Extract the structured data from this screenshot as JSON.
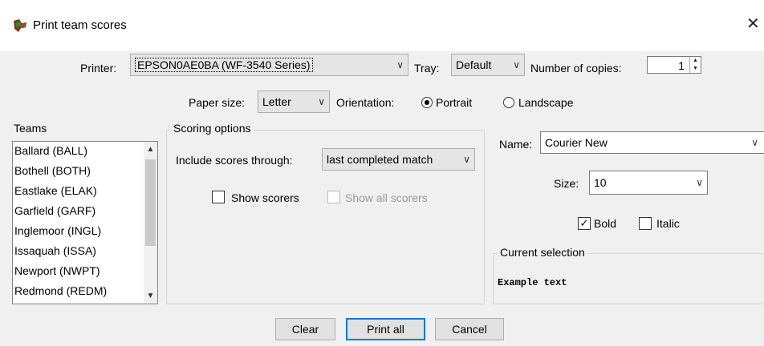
{
  "window": {
    "title": "Print team scores",
    "close_glyph": "✕",
    "icon": "app-icon"
  },
  "printer": {
    "label": "Printer:",
    "value": "EPSON0AE0BA (WF-3540 Series)",
    "tray_label": "Tray:",
    "tray_value": "Default",
    "copies_label": "Number of copies:",
    "copies_value": "1"
  },
  "paper": {
    "size_label": "Paper size:",
    "size_value": "Letter",
    "orientation_label": "Orientation:",
    "portrait_label": "Portrait",
    "landscape_label": "Landscape",
    "orientation_selected": "Portrait"
  },
  "teams": {
    "title": "Teams",
    "items": [
      "Ballard (BALL)",
      "Bothell (BOTH)",
      "Eastlake (ELAK)",
      "Garfield (GARF)",
      "Inglemoor (INGL)",
      "Issaquah (ISSA)",
      "Newport (NWPT)",
      "Redmond (REDM)"
    ]
  },
  "scoring": {
    "title": "Scoring options",
    "include_label": "Include scores through:",
    "include_value": "last completed match",
    "show_scorers_label": "Show scorers",
    "show_scorers_checked": false,
    "show_all_scorers_label": "Show all scorers",
    "show_all_scorers_enabled": false
  },
  "font": {
    "name_label": "Name:",
    "name_value": "Courier New",
    "size_label": "Size:",
    "size_value": "10",
    "bold_label": "Bold",
    "bold_checked": true,
    "italic_label": "Italic",
    "italic_checked": false,
    "current_selection_title": "Current selection",
    "example_text": "Example text"
  },
  "buttons": {
    "clear": "Clear",
    "print_all": "Print all",
    "cancel": "Cancel"
  },
  "glyphs": {
    "chevron": "∨",
    "check": "✓",
    "up": "▲",
    "down": "▼"
  }
}
